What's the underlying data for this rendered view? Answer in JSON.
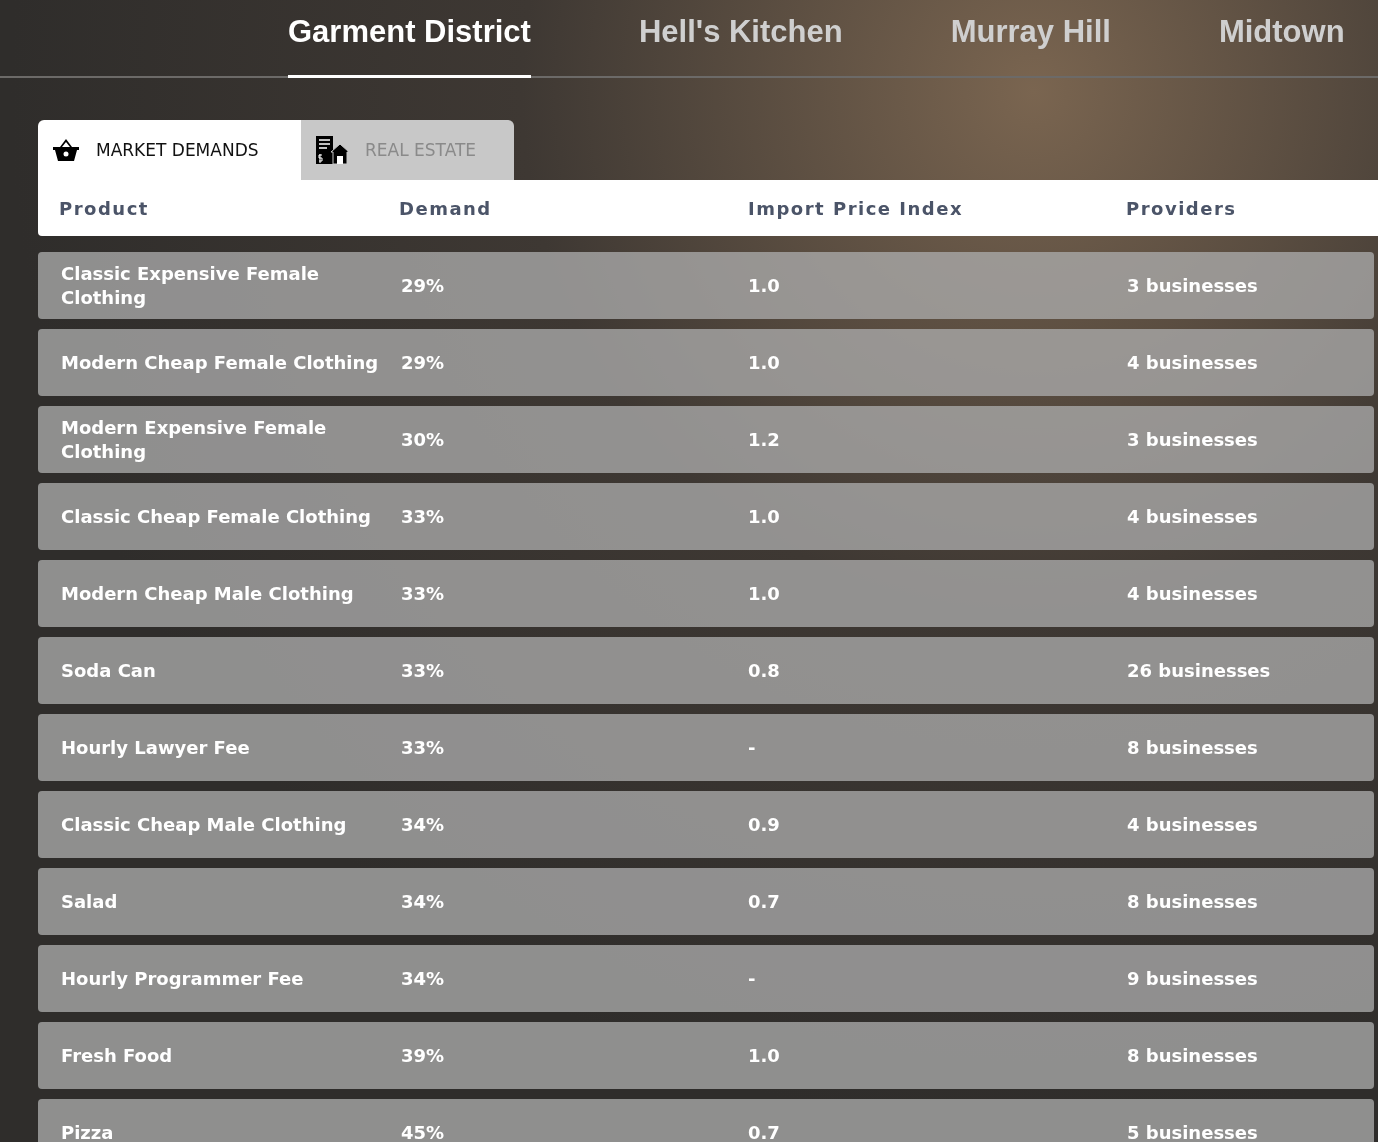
{
  "districts": [
    {
      "label": "Garment District",
      "selected": true
    },
    {
      "label": "Hell's Kitchen",
      "selected": false
    },
    {
      "label": "Murray Hill",
      "selected": false
    },
    {
      "label": "Midtown",
      "selected": false
    }
  ],
  "tabs": [
    {
      "label": "MARKET DEMANDS",
      "kind": "basket",
      "selected": true
    },
    {
      "label": "REAL ESTATE",
      "kind": "estate",
      "selected": false
    }
  ],
  "table": {
    "columns": [
      "Product",
      "Demand",
      "Import Price Index",
      "Providers"
    ],
    "rows": [
      [
        "Classic Expensive Female Clothing",
        "29%",
        "1.0",
        "3 businesses"
      ],
      [
        "Modern Cheap Female Clothing",
        "29%",
        "1.0",
        "4 businesses"
      ],
      [
        "Modern Expensive Female Clothing",
        "30%",
        "1.2",
        "3 businesses"
      ],
      [
        "Classic Cheap Female Clothing",
        "33%",
        "1.0",
        "4 businesses"
      ],
      [
        "Modern Cheap Male Clothing",
        "33%",
        "1.0",
        "4 businesses"
      ],
      [
        "Soda Can",
        "33%",
        "0.8",
        "26 businesses"
      ],
      [
        "Hourly Lawyer Fee",
        "33%",
        "-",
        "8 businesses"
      ],
      [
        "Classic Cheap Male Clothing",
        "34%",
        "0.9",
        "4 businesses"
      ],
      [
        "Salad",
        "34%",
        "0.7",
        "8 businesses"
      ],
      [
        "Hourly Programmer Fee",
        "34%",
        "-",
        "9 businesses"
      ],
      [
        "Fresh Food",
        "39%",
        "1.0",
        "8 businesses"
      ],
      [
        "Pizza",
        "45%",
        "0.7",
        "5 businesses"
      ]
    ]
  }
}
